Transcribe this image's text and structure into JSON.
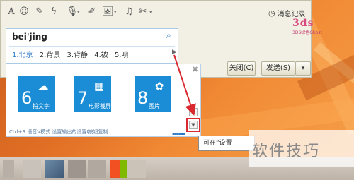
{
  "chat_window": {
    "toolbar": {
      "font_icon": "A",
      "emoji_icon": "☺",
      "magic_icon": "✎",
      "flash_icon": "ϟ",
      "mic_icon": "🎙",
      "edit_icon": "✐",
      "image_icon": "🖼",
      "music_icon": "♫",
      "scissors_icon": "✂",
      "dropdown_glyph": "▾"
    },
    "history_label": "消息记录",
    "history_icon": "◷",
    "close_label": "关闭(C)",
    "send_label": "发送(S)",
    "send_dropdown": "▾"
  },
  "logo": {
    "text": "3ds",
    "subtitle": "3DS绿色Ghost"
  },
  "ime": {
    "pinyin": "bei'jing",
    "search_icon": "⌕",
    "candidates": [
      "1.北京",
      "2.背景",
      "3.背静",
      "4.被",
      "5.呗"
    ],
    "next_page": "▶"
  },
  "panel": {
    "close_glyph": "✖",
    "tiles": [
      {
        "number": "6",
        "label": "拍文字",
        "icon": "☁"
      },
      {
        "number": "7",
        "label": "电影截屏",
        "icon": "▦"
      },
      {
        "number": "8",
        "label": "图片",
        "icon": "✿"
      }
    ],
    "scroll_up": "▲",
    "scroll_down": "▼",
    "hint": "Ctrl+R 语音V模式  设置输出的设置Ⅰ按钮复制",
    "dots": "▪▪▪▪▪▪"
  },
  "tooltip": "可在“设置",
  "watermark": "软件技巧",
  "colors": {
    "tile_blue": "#1b8dd6",
    "annotation_red": "#d9282f",
    "candidate_blue": "#2c77c6"
  }
}
